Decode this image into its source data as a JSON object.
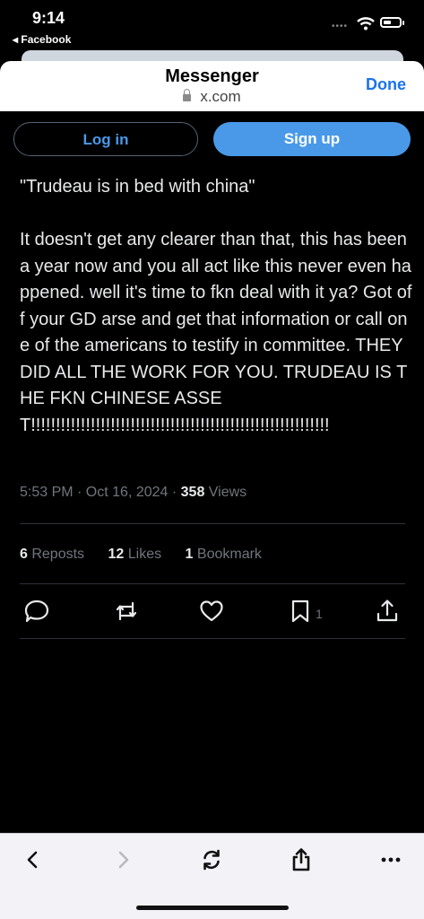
{
  "status_bar": {
    "time": "9:14",
    "back_app": "◂ Facebook"
  },
  "browser_sheet": {
    "title": "Messenger",
    "url": "x.com",
    "done_label": "Done"
  },
  "auth": {
    "login_label": "Log in",
    "signup_label": "Sign up"
  },
  "tweet": {
    "text": "\"Trudeau is in bed with china\"\n\nIt doesn't get any clearer than that, this has been a year now and you all act like this never even happened. well it's time to fkn deal with it ya? Got off your GD arse and get that information or call one of the americans to testify in committee. THEY DID ALL THE WORK FOR YOU. TRUDEAU IS THE FKN CHINESE ASSET!!!!!!!!!!!!!!!!!!!!!!!!!!!!!!!!!!!!!!!!!!!!!!!!!!!!!!!!!!!!",
    "timestamp": "5:53 PM · Oct 16, 2024 · ",
    "views_count": "358",
    "views_label": " Views"
  },
  "stats": {
    "reposts_count": "6",
    "reposts_label": " Reposts",
    "likes_count": "12",
    "likes_label": " Likes",
    "bookmarks_count": "1",
    "bookmarks_label": " Bookmark"
  },
  "actions": {
    "reply_icon": "reply-icon",
    "repost_icon": "repost-icon",
    "like_icon": "like-icon",
    "bookmark_icon": "bookmark-icon",
    "bookmark_count": "1",
    "share_icon": "share-icon"
  },
  "toolbar": {
    "back_icon": "chevron-left-icon",
    "forward_icon": "chevron-right-icon",
    "reload_icon": "reload-icon",
    "share_icon": "share-icon",
    "more_icon": "more-icon"
  },
  "colors": {
    "accent": "#4a99e9",
    "background": "#000000",
    "muted": "#71767b"
  }
}
